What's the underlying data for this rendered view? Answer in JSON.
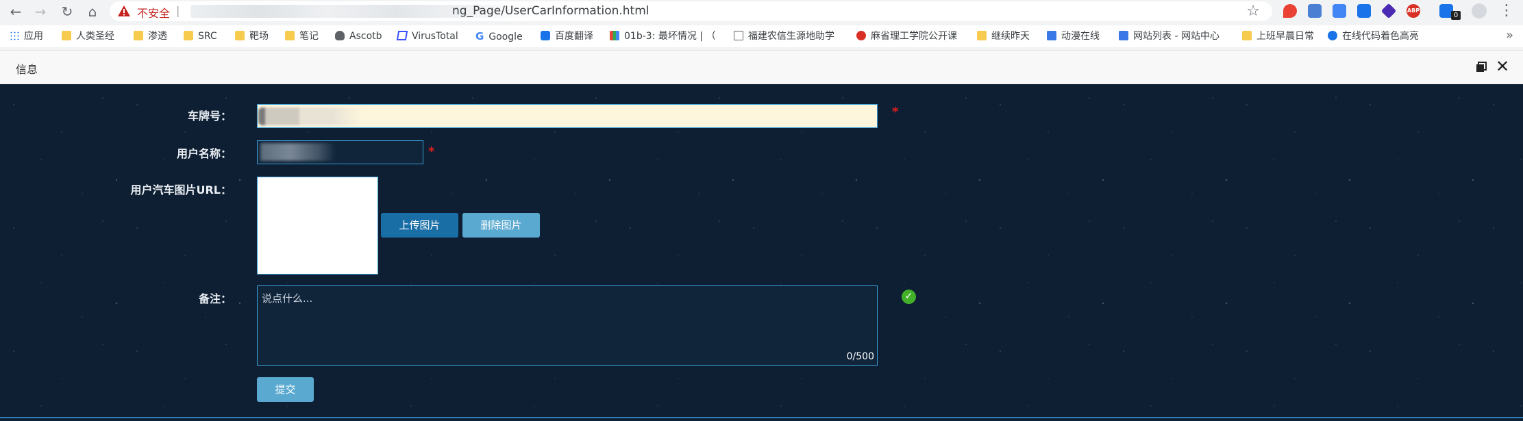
{
  "browser": {
    "insecure_label": "不安全",
    "separator": "|",
    "url_visible": "ng_Page/UserCarInformation.html"
  },
  "bookmarks": [
    {
      "label": "应用",
      "icon": "apps-grid-icon"
    },
    {
      "label": "人类圣经",
      "icon": "folder-icon"
    },
    {
      "label": "渗透",
      "icon": "folder-icon"
    },
    {
      "label": "SRC",
      "icon": "folder-icon"
    },
    {
      "label": "靶场",
      "icon": "folder-icon"
    },
    {
      "label": "笔记",
      "icon": "folder-icon"
    },
    {
      "label": "Ascotb",
      "icon": "person-icon"
    },
    {
      "label": "VirusTotal",
      "icon": "virustotal-icon"
    },
    {
      "label": "Google",
      "icon": "google-icon"
    },
    {
      "label": "百度翻译",
      "icon": "baidu-translate-icon"
    },
    {
      "label": "01b-3: 最坏情况 | （",
      "icon": "multicolor-icon"
    },
    {
      "label": "福建农信生源地助学",
      "icon": "file-icon"
    },
    {
      "label": "麻省理工学院公开课",
      "icon": "netease-icon"
    },
    {
      "label": "继续昨天",
      "icon": "folder-icon"
    },
    {
      "label": "动漫在线",
      "icon": "image-icon"
    },
    {
      "label": "网站列表 - 网站中心",
      "icon": "chart-icon"
    },
    {
      "label": "上班早晨日常",
      "icon": "folder-icon"
    },
    {
      "label": "在线代码着色高亮",
      "icon": "refresh-c-icon"
    }
  ],
  "extension_badge": "0",
  "layer": {
    "title": "信息"
  },
  "form": {
    "plate_label": "车牌号：",
    "user_name_label": "用户名称：",
    "image_url_label": "用户汽车图片URL：",
    "remark_label": "备注：",
    "required_mark": "*",
    "upload_button": "上传图片",
    "delete_button": "删除图片",
    "remark_placeholder": "说点什么...",
    "remark_counter": "0/500",
    "submit_button": "提交",
    "ok_mark": "✓"
  },
  "colors": {
    "background": "#0f1f33",
    "accent_border": "#3aa0d8",
    "upload_button": "#1a6ea6",
    "light_button": "#5aa9d0",
    "required": "#e02020",
    "ok": "#43b02a"
  }
}
